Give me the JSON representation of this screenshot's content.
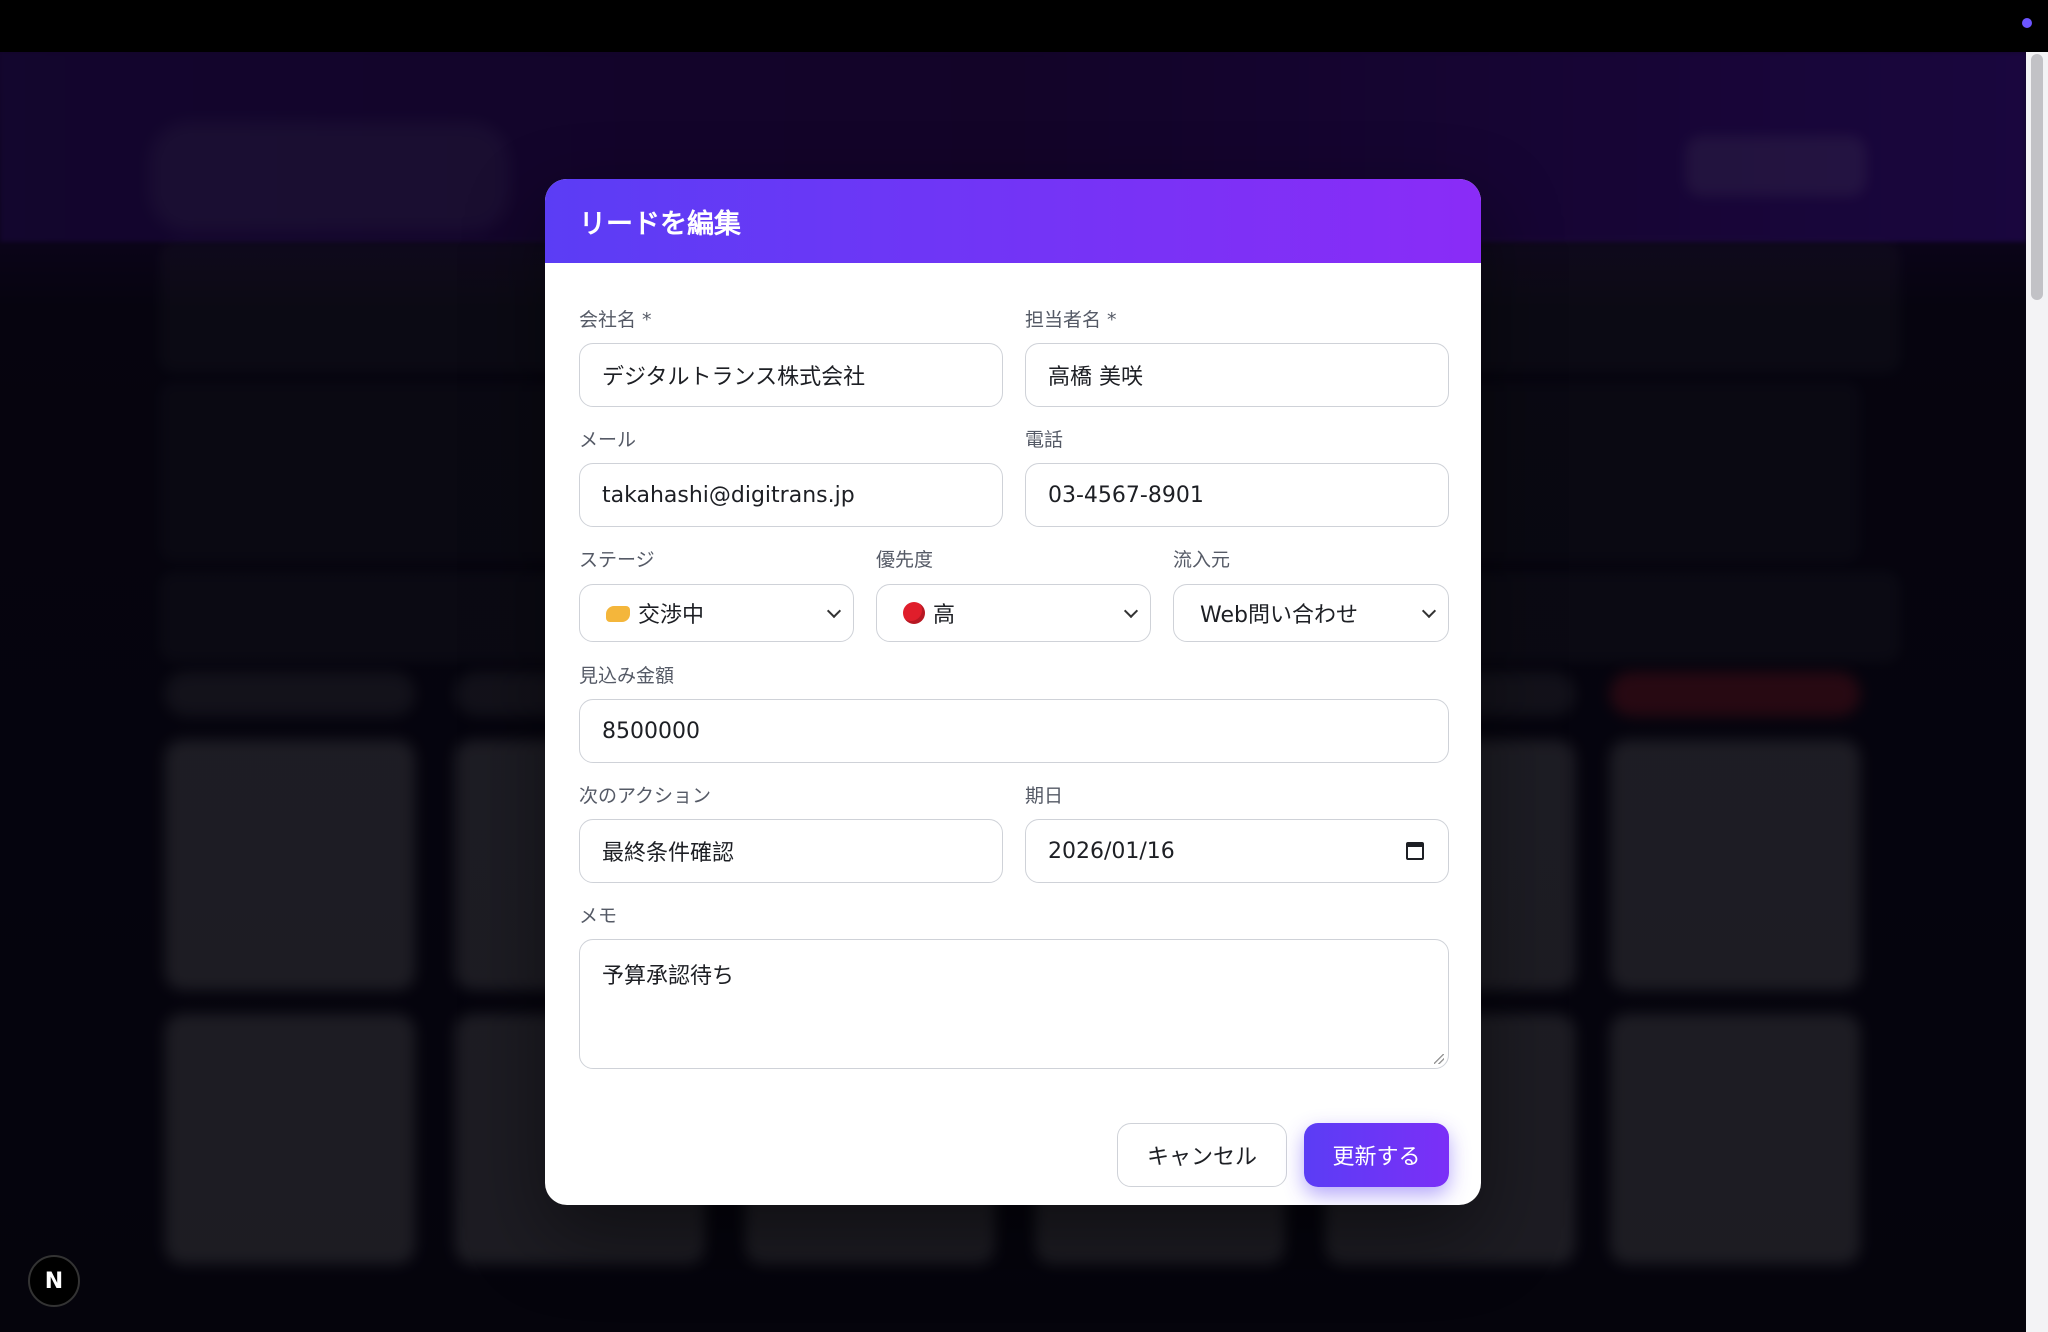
{
  "modal": {
    "title": "リードを編集",
    "fields": {
      "company": {
        "label": "会社名 *",
        "value": "デジタルトランス株式会社"
      },
      "contact": {
        "label": "担当者名 *",
        "value": "高橋 美咲"
      },
      "email": {
        "label": "メール",
        "value": "takahashi@digitrans.jp"
      },
      "phone": {
        "label": "電話",
        "value": "03-4567-8901"
      },
      "stage": {
        "label": "ステージ",
        "value": "交渉中",
        "icon": "handshake-icon"
      },
      "priority": {
        "label": "優先度",
        "value": "高",
        "icon": "red-circle-icon"
      },
      "source": {
        "label": "流入元",
        "value": "Web問い合わせ"
      },
      "amount": {
        "label": "見込み金額",
        "value": "8500000"
      },
      "next_action": {
        "label": "次のアクション",
        "value": "最終条件確認"
      },
      "due_date": {
        "label": "期日",
        "value": "2026/01/16"
      },
      "memo": {
        "label": "メモ",
        "value": "予算承認待ち"
      }
    },
    "buttons": {
      "cancel": "キャンセル",
      "submit": "更新する"
    }
  },
  "badge": {
    "letter": "N"
  },
  "colors": {
    "accent_start": "#5b3df5",
    "accent_end": "#8a2cf7",
    "priority_high": "#e01e2b"
  }
}
